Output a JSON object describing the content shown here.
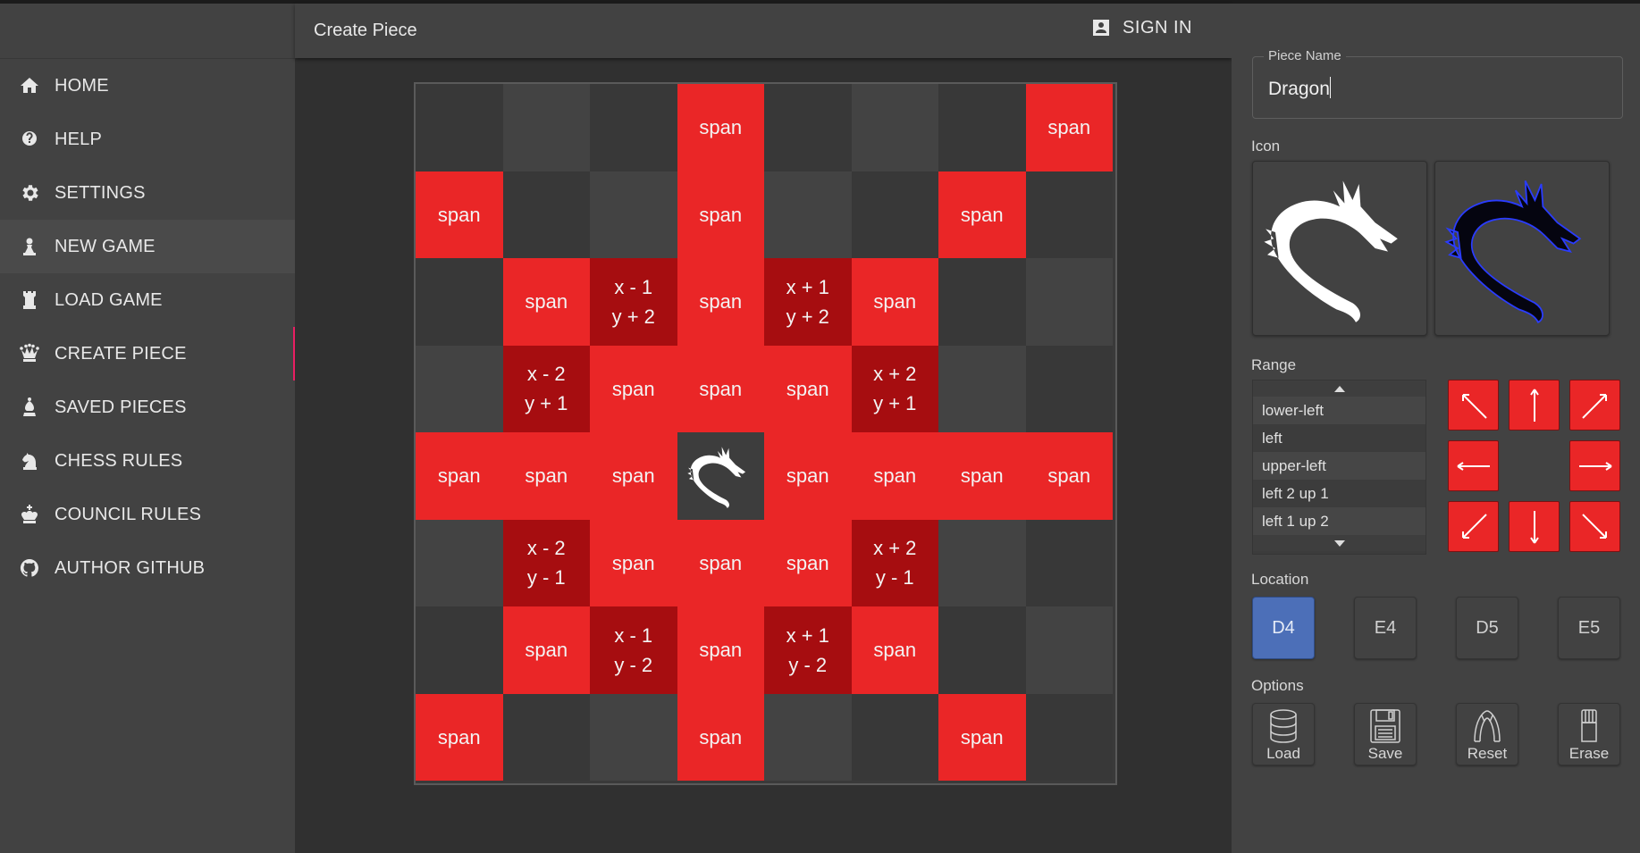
{
  "sidebar": {
    "items": [
      {
        "label": "HOME",
        "icon": "home-icon"
      },
      {
        "label": "HELP",
        "icon": "help-icon"
      },
      {
        "label": "SETTINGS",
        "icon": "gear-icon"
      },
      {
        "label": "NEW GAME",
        "icon": "pawn-icon"
      },
      {
        "label": "LOAD GAME",
        "icon": "rook-icon"
      },
      {
        "label": "CREATE PIECE",
        "icon": "queen-icon"
      },
      {
        "label": "SAVED PIECES",
        "icon": "bishop-icon"
      },
      {
        "label": "CHESS RULES",
        "icon": "knight-icon"
      },
      {
        "label": "COUNCIL RULES",
        "icon": "king-icon"
      },
      {
        "label": "AUTHOR GITHUB",
        "icon": "github-icon"
      }
    ]
  },
  "header": {
    "title": "Create Piece",
    "signin": "SIGN IN"
  },
  "board": {
    "rows": [
      [
        [
          "d",
          ""
        ],
        [
          "l",
          ""
        ],
        [
          "d",
          ""
        ],
        [
          "r",
          "span"
        ],
        [
          "d",
          ""
        ],
        [
          "l",
          ""
        ],
        [
          "d",
          ""
        ],
        [
          "r",
          "span"
        ]
      ],
      [
        [
          "r",
          "span"
        ],
        [
          "d",
          ""
        ],
        [
          "l",
          ""
        ],
        [
          "r",
          "span"
        ],
        [
          "l",
          ""
        ],
        [
          "d",
          ""
        ],
        [
          "r",
          "span"
        ],
        [
          "d",
          ""
        ]
      ],
      [
        [
          "d",
          ""
        ],
        [
          "r",
          "span"
        ],
        [
          "dr",
          "x - 1|y + 2"
        ],
        [
          "r",
          "span"
        ],
        [
          "dr",
          "x + 1|y + 2"
        ],
        [
          "r",
          "span"
        ],
        [
          "d",
          ""
        ],
        [
          "l",
          ""
        ]
      ],
      [
        [
          "l",
          ""
        ],
        [
          "dr",
          "x - 2|y + 1"
        ],
        [
          "r",
          "span"
        ],
        [
          "r",
          "span"
        ],
        [
          "r",
          "span"
        ],
        [
          "dr",
          "x + 2|y + 1"
        ],
        [
          "l",
          ""
        ],
        [
          "d",
          ""
        ]
      ],
      [
        [
          "r",
          "span"
        ],
        [
          "r",
          "span"
        ],
        [
          "r",
          "span"
        ],
        [
          "piece",
          "dragon"
        ],
        [
          "r",
          "span"
        ],
        [
          "r",
          "span"
        ],
        [
          "r",
          "span"
        ],
        [
          "r",
          "span"
        ]
      ],
      [
        [
          "l",
          ""
        ],
        [
          "dr",
          "x - 2|y - 1"
        ],
        [
          "r",
          "span"
        ],
        [
          "r",
          "span"
        ],
        [
          "r",
          "span"
        ],
        [
          "dr",
          "x + 2|y - 1"
        ],
        [
          "l",
          ""
        ],
        [
          "d",
          ""
        ]
      ],
      [
        [
          "d",
          ""
        ],
        [
          "r",
          "span"
        ],
        [
          "dr",
          "x - 1|y - 2"
        ],
        [
          "r",
          "span"
        ],
        [
          "dr",
          "x + 1|y - 2"
        ],
        [
          "r",
          "span"
        ],
        [
          "d",
          ""
        ],
        [
          "l",
          ""
        ]
      ],
      [
        [
          "r",
          "span"
        ],
        [
          "d",
          ""
        ],
        [
          "l",
          ""
        ],
        [
          "r",
          "span"
        ],
        [
          "l",
          ""
        ],
        [
          "d",
          ""
        ],
        [
          "r",
          "span"
        ],
        [
          "d",
          ""
        ]
      ]
    ]
  },
  "panel": {
    "piece_name_label": "Piece Name",
    "piece_name_value": "Dragon",
    "icon_label": "Icon",
    "range_label": "Range",
    "range_options": [
      "lower-left",
      "left",
      "upper-left",
      "left 2 up 1",
      "left 1 up 2"
    ],
    "location_label": "Location",
    "locations": [
      "D4",
      "E4",
      "D5",
      "E5"
    ],
    "selected_location": "D4",
    "options_label": "Options",
    "options": [
      "Load",
      "Save",
      "Reset",
      "Erase"
    ]
  },
  "colors": {
    "span": "#ea2627",
    "offset": "#a60d10",
    "selected": "#4c6fb8",
    "active": "#e91e63"
  }
}
